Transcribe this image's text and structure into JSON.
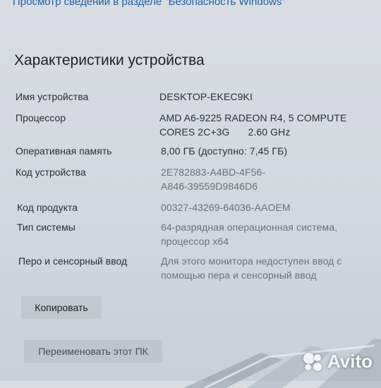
{
  "header": {
    "link_text": "Просмотр сведений в разделе \"Безопасность Windows\""
  },
  "section": {
    "title": "Характеристики устройства"
  },
  "specs": [
    {
      "label": "Имя устройства",
      "value": "DESKTOP-EKEC9KI"
    },
    {
      "label": "Процессор",
      "value_line1": "AMD A6-9225 RADEON R4, 5 COMPUTE",
      "value_line2": "CORES 2C+3G",
      "value_line2b": "2.60 GHz"
    },
    {
      "label": "Оперативная память",
      "value": "8,00 ГБ (доступно: 7,45 ГБ)"
    },
    {
      "label": "Код устройства",
      "value_line1": "2E782883-A4BD-4F56-",
      "value_line2": "A846-39559D9846D6"
    },
    {
      "label": "Код продукта",
      "value": "00327-43269-64036-AAOEM"
    },
    {
      "label": "Тип системы",
      "value_line1": "64-разрядная операционная система,",
      "value_line2": "процессор x64"
    },
    {
      "label": "Перо и сенсорный ввод",
      "value_line1": "Для этого монитора недоступен ввод с",
      "value_line2": "помощью пера и сенсорный ввод"
    }
  ],
  "buttons": {
    "copy": "Копировать",
    "rename": "Переименовать этот ПК"
  },
  "watermark": {
    "text": "Avito"
  }
}
